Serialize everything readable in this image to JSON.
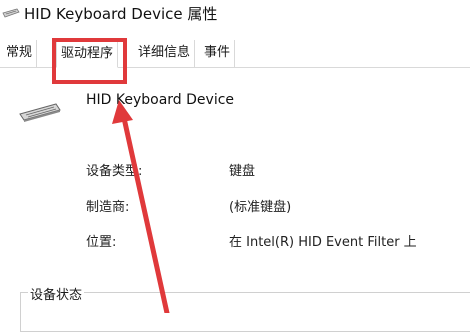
{
  "window": {
    "title": "HID Keyboard Device 属性"
  },
  "tabs": [
    {
      "label": "常规"
    },
    {
      "label": "驱动程序"
    },
    {
      "label": "详细信息"
    },
    {
      "label": "事件"
    }
  ],
  "device": {
    "name": "HID Keyboard Device",
    "icon": "keyboard-icon"
  },
  "properties": [
    {
      "label": "设备类型:",
      "value": "键盘"
    },
    {
      "label": "制造商:",
      "value": "(标准键盘)"
    },
    {
      "label": "位置:",
      "value": "在 Intel(R) HID Event Filter 上"
    }
  ],
  "status_group": {
    "label": "设备状态"
  },
  "annotation": {
    "color": "#e0393b"
  }
}
